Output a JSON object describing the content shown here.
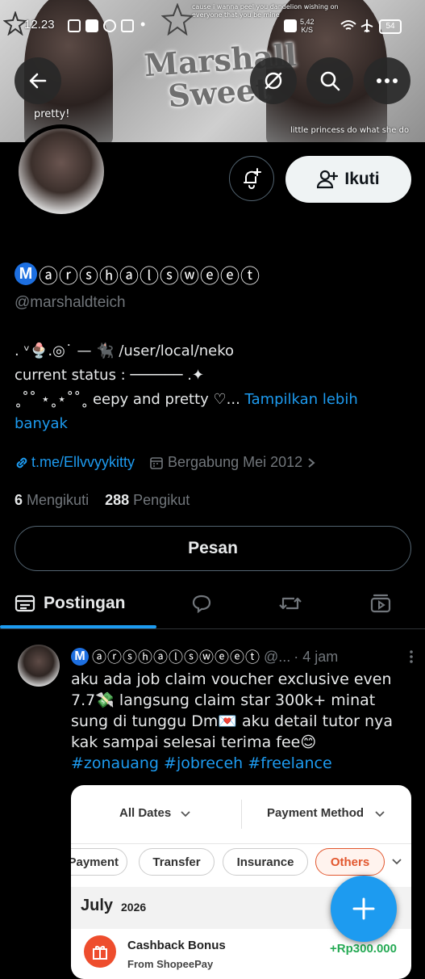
{
  "status_bar": {
    "time": "12.23",
    "speed_value": "5,42",
    "speed_unit": "K/S",
    "battery": "54"
  },
  "banner": {
    "title_line1": "Marshall",
    "title_line2": "Sweet",
    "caption_left": "pretty!",
    "caption_right": "little princess do what she do",
    "quote": "cause i wanna peel you dandelion wishing on everyone that you be mine"
  },
  "profile": {
    "badge_letter": "M",
    "display_name": "ⓐⓡⓢⓗⓐⓛⓢⓦⓔⓔⓣ",
    "handle": "@marshaldteich",
    "follow_label": "Ikuti",
    "bio_line1": ". ᵛ🍨.◎˙ — 🐈‍⬛ /user/local/neko",
    "bio_line2": "  current status : ────── .✦",
    "bio_line3": " ˳˚˚ ⋆˳⋆˚˚˳ eepy and pretty ♡...",
    "bio_more": "Tampilkan lebih banyak",
    "link": "t.me/Ellvvyykitty",
    "joined": "Bergabung Mei 2012",
    "following_count": "6",
    "following_label": "Mengikuti",
    "followers_count": "288",
    "followers_label": "Pengikut",
    "message_label": "Pesan"
  },
  "tabs": {
    "posts_label": "Postingan"
  },
  "post": {
    "badge_letter": "M",
    "author_name": "ⓐⓡⓢⓗⓐⓛⓢⓦⓔⓔⓣ",
    "author_suffix": "@...",
    "time": "· 4 jam",
    "text": "aku ada job claim voucher exclusive even 7.7💸 langsung claim star 300k+ minat sung di tunggu Dm💌 aku detail tutor nya kak sampai selesai terima fee😊",
    "hashtags": "#zonauang #jobreceh #freelance"
  },
  "card": {
    "filter_dates": "All Dates",
    "filter_method": "Payment Method",
    "chip_payment": "Payment",
    "chip_transfer": "Transfer",
    "chip_insurance": "Insurance",
    "chip_others": "Others",
    "month": "July",
    "year": "2026",
    "tx_title": "Cashback Bonus",
    "tx_sub": "From ShopeePay",
    "tx_amount": "+Rp300.000"
  },
  "colors": {
    "accent": "#1d9bf0",
    "background": "#000000",
    "secondary_text": "#71767b",
    "shopee_orange": "#ee4d2d",
    "amount_green": "#26aa55"
  }
}
